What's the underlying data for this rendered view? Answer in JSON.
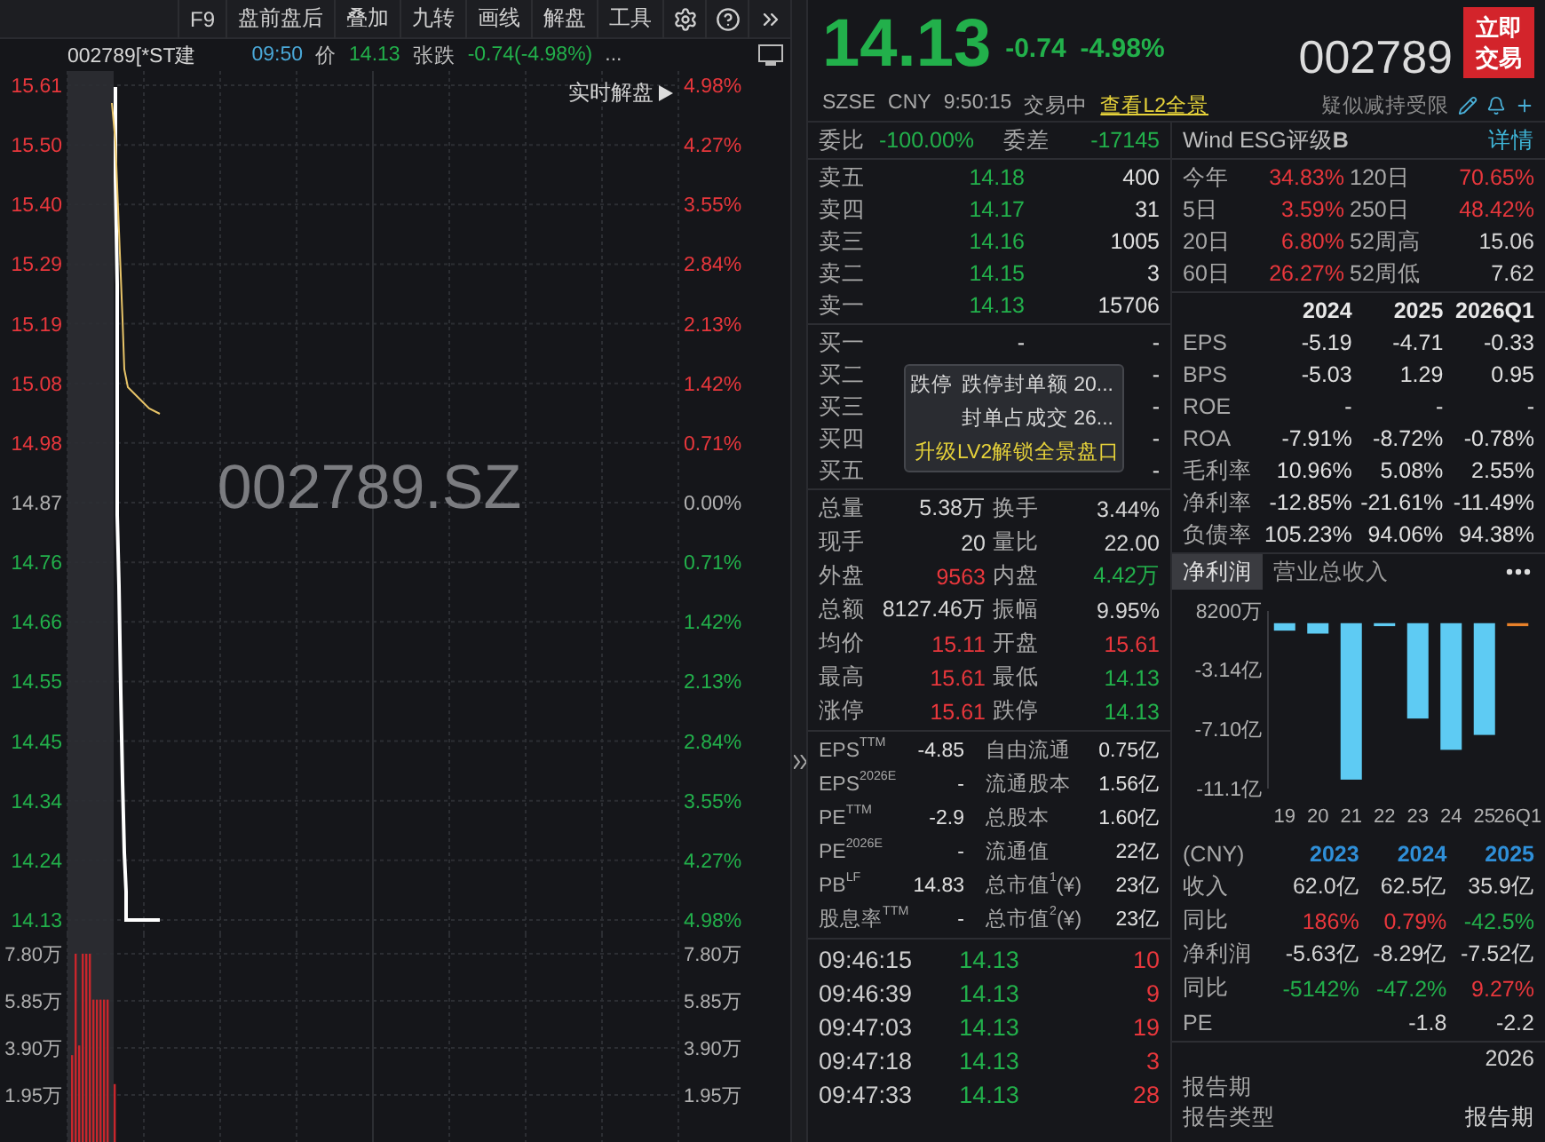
{
  "toolbar": {
    "buttons": [
      "F9",
      "盘前盘后",
      "叠加",
      "九转",
      "画线",
      "解盘",
      "工具"
    ]
  },
  "quote_line": {
    "name": "002789[*ST建",
    "time": "09:50",
    "price_label": "价",
    "price": "14.13",
    "change_label": "张跌",
    "change": "-0.74(-4.98%)",
    "color": "#22b04b",
    "more": "..."
  },
  "intraday_chart": {
    "watermark": "002789.SZ",
    "analysis_button": "实时解盘",
    "price_axis": [
      {
        "label": "15.61",
        "color": "#e8373c"
      },
      {
        "label": "15.50",
        "color": "#e8373c"
      },
      {
        "label": "15.40",
        "color": "#e8373c"
      },
      {
        "label": "15.29",
        "color": "#e8373c"
      },
      {
        "label": "15.19",
        "color": "#e8373c"
      },
      {
        "label": "15.08",
        "color": "#e8373c"
      },
      {
        "label": "14.98",
        "color": "#e8373c"
      },
      {
        "label": "14.87",
        "color": "#b0b0b0"
      },
      {
        "label": "14.76",
        "color": "#22b04b"
      },
      {
        "label": "14.66",
        "color": "#22b04b"
      },
      {
        "label": "14.55",
        "color": "#22b04b"
      },
      {
        "label": "14.45",
        "color": "#22b04b"
      },
      {
        "label": "14.34",
        "color": "#22b04b"
      },
      {
        "label": "14.24",
        "color": "#22b04b"
      },
      {
        "label": "14.13",
        "color": "#22b04b"
      }
    ],
    "percent_axis": [
      {
        "label": "4.98%",
        "color": "#e8373c"
      },
      {
        "label": "4.27%",
        "color": "#e8373c"
      },
      {
        "label": "3.55%",
        "color": "#e8373c"
      },
      {
        "label": "2.84%",
        "color": "#e8373c"
      },
      {
        "label": "2.13%",
        "color": "#e8373c"
      },
      {
        "label": "1.42%",
        "color": "#e8373c"
      },
      {
        "label": "0.71%",
        "color": "#e8373c"
      },
      {
        "label": "0.00%",
        "color": "#b0b0b0"
      },
      {
        "label": "0.71%",
        "color": "#22b04b"
      },
      {
        "label": "1.42%",
        "color": "#22b04b"
      },
      {
        "label": "2.13%",
        "color": "#22b04b"
      },
      {
        "label": "2.84%",
        "color": "#22b04b"
      },
      {
        "label": "3.55%",
        "color": "#22b04b"
      },
      {
        "label": "4.27%",
        "color": "#22b04b"
      },
      {
        "label": "4.98%",
        "color": "#22b04b"
      }
    ],
    "volume_axis_left": [
      "7.80万",
      "5.85万",
      "3.90万",
      "1.95万"
    ],
    "volume_axis_right": [
      "7.80万",
      "5.85万",
      "3.90万",
      "1.95万"
    ]
  },
  "quote": {
    "price": "14.13",
    "change": "-0.74",
    "change_pct": "-4.98%",
    "color": "#22b04b",
    "exchange": "SZSE",
    "currency": "CNY",
    "time": "9:50:15",
    "status": "交易中",
    "l2_link": "查看L2全景",
    "code": "002789",
    "trade_button": "立即交易",
    "notice": "疑似减持受限"
  },
  "order_book": {
    "ratio_label": "委比",
    "ratio": "-100.00%",
    "diff_label": "委差",
    "diff": "-17145",
    "color": "#22b04b",
    "asks": [
      {
        "label": "卖五",
        "price": "14.18",
        "volume": "400"
      },
      {
        "label": "卖四",
        "price": "14.17",
        "volume": "31"
      },
      {
        "label": "卖三",
        "price": "14.16",
        "volume": "1005"
      },
      {
        "label": "卖二",
        "price": "14.15",
        "volume": "3"
      },
      {
        "label": "卖一",
        "price": "14.13",
        "volume": "15706"
      }
    ],
    "bids": [
      {
        "label": "买一",
        "price": "-",
        "volume": "-"
      },
      {
        "label": "买二",
        "volume": "-"
      },
      {
        "label": "买三",
        "volume": "-"
      },
      {
        "label": "买四",
        "volume": "-"
      },
      {
        "label": "买五",
        "volume": "-"
      }
    ],
    "popup": {
      "tag": "跌停",
      "lines": [
        {
          "label": "跌停封单额",
          "value": "20..."
        },
        {
          "label": "封单占成交",
          "value": "26..."
        }
      ],
      "promo": "升级LV2解锁全景盘口"
    }
  },
  "stats": [
    {
      "label": "总量",
      "value": "5.38万",
      "color": "#d6d6d6"
    },
    {
      "label": "换手",
      "value": "3.44%",
      "color": "#d6d6d6"
    },
    {
      "label": "现手",
      "value": "20",
      "color": "#d6d6d6"
    },
    {
      "label": "量比",
      "value": "22.00",
      "color": "#d6d6d6"
    },
    {
      "label": "外盘",
      "value": "9563",
      "color": "#e8373c"
    },
    {
      "label": "内盘",
      "value": "4.42万",
      "color": "#22b04b"
    },
    {
      "label": "总额",
      "value": "8127.46万",
      "color": "#d6d6d6"
    },
    {
      "label": "振幅",
      "value": "9.95%",
      "color": "#d6d6d6"
    },
    {
      "label": "均价",
      "value": "15.11",
      "color": "#e8373c"
    },
    {
      "label": "开盘",
      "value": "15.61",
      "color": "#e8373c"
    },
    {
      "label": "最高",
      "value": "15.61",
      "color": "#e8373c"
    },
    {
      "label": "最低",
      "value": "14.13",
      "color": "#22b04b"
    },
    {
      "label": "涨停",
      "value": "15.61",
      "color": "#e8373c"
    },
    {
      "label": "跌停",
      "value": "14.13",
      "color": "#22b04b"
    }
  ],
  "valuation": [
    {
      "label": "EPS$^{TTM}$",
      "value": "-4.85"
    },
    {
      "label": "自由流通",
      "value": "0.75亿"
    },
    {
      "label": "EPS$^{2026E}$",
      "value": "-"
    },
    {
      "label": "流通股本",
      "value": "1.56亿"
    },
    {
      "label": "PE$^{TTM}$",
      "value": "-2.9"
    },
    {
      "label": "总股本",
      "value": "1.60亿"
    },
    {
      "label": "PE$^{2026E}$",
      "value": "-"
    },
    {
      "label": "流通值",
      "value": "22亿"
    },
    {
      "label": "PB$^{LF}$",
      "value": "14.83"
    },
    {
      "label": "总市值$^{1}$(¥)",
      "value": "23亿"
    },
    {
      "label": "股息率$^{TTM}$",
      "value": "-"
    },
    {
      "label": "总市值$^{2}$(¥)",
      "value": "23亿"
    }
  ],
  "ticks": [
    {
      "time": "09:46:15",
      "price": {
        "text": "14.13",
        "color": "#22b04b"
      },
      "volume": {
        "text": "10",
        "color": "#e8373c"
      }
    },
    {
      "time": "09:46:39",
      "price": {
        "text": "14.13",
        "color": "#22b04b"
      },
      "volume": {
        "text": "9",
        "color": "#e8373c"
      }
    },
    {
      "time": "09:47:03",
      "price": {
        "text": "14.13",
        "color": "#22b04b"
      },
      "volume": {
        "text": "19",
        "color": "#e8373c"
      }
    },
    {
      "time": "09:47:18",
      "price": {
        "text": "14.13",
        "color": "#22b04b"
      },
      "volume": {
        "text": "3",
        "color": "#e8373c"
      }
    },
    {
      "time": "09:47:33",
      "price": {
        "text": "14.13",
        "color": "#22b04b"
      },
      "volume": {
        "text": "28",
        "color": "#e8373c"
      }
    }
  ],
  "esg": {
    "label": "Wind ESG评级**B**",
    "details_link": "详情"
  },
  "returns": [
    {
      "label": "今年",
      "value": "34.83%",
      "color": "#e8373c"
    },
    {
      "label": "120日",
      "value": "70.65%",
      "color": "#e8373c"
    },
    {
      "label": "5日",
      "value": "3.59%",
      "color": "#e8373c"
    },
    {
      "label": "250日",
      "value": "48.42%",
      "color": "#e8373c"
    },
    {
      "label": "20日",
      "value": "6.80%",
      "color": "#e8373c"
    },
    {
      "label": "52周高",
      "value": "15.06",
      "color": "#d6d6d6"
    },
    {
      "label": "60日",
      "value": "26.27%",
      "color": "#e8373c"
    },
    {
      "label": "52周低",
      "value": "7.62",
      "color": "#d6d6d6"
    }
  ],
  "financials": {
    "columns": [
      "2024",
      "2025",
      "2026Q1"
    ],
    "rows": [
      {
        "label": "EPS",
        "values": [
          "-5.19",
          "-4.71",
          "-0.33"
        ]
      },
      {
        "label": "BPS",
        "values": [
          "-5.03",
          "1.29",
          "0.95"
        ]
      },
      {
        "label": "ROE",
        "values": [
          "-",
          "-",
          "-"
        ]
      },
      {
        "label": "ROA",
        "values": [
          "-7.91%",
          "-8.72%",
          "-0.78%"
        ]
      },
      {
        "label": "毛利率",
        "values": [
          "10.96%",
          "5.08%",
          "2.55%"
        ]
      },
      {
        "label": "净利率",
        "values": [
          "-12.85%",
          "-21.61%",
          "-11.49%"
        ]
      },
      {
        "label": "负债率",
        "values": [
          "105.23%",
          "94.06%",
          "94.38%"
        ]
      }
    ]
  },
  "profit_tabs": [
    {
      "label": "净利润",
      "selected": true
    },
    {
      "label": "营业总收入",
      "selected": false
    }
  ],
  "profit_chart": {
    "top_label": "8200万",
    "chart_data": {
      "type": "bar",
      "categories": [
        "19",
        "20",
        "21",
        "22",
        "23",
        "24",
        "25",
        "26Q1"
      ],
      "ylim": [
        -11.1,
        0.82
      ],
      "yticks": [
        {
          "value": -3.14,
          "label": "-3.14亿"
        },
        {
          "value": -7.1,
          "label": "-7.10亿"
        },
        {
          "value": -11.1,
          "label": "-11.1亿"
        }
      ],
      "series": [
        {
          "color": "#5ecbf3",
          "values": [
            -0.5,
            -0.7,
            -10.5,
            -0.2,
            -6.4,
            -8.5,
            -7.5,
            null
          ]
        },
        {
          "color": "#e8812a",
          "values": [
            null,
            null,
            null,
            null,
            null,
            null,
            null,
            -0.2
          ]
        }
      ]
    }
  },
  "summary": {
    "columns": [
      "(CNY)",
      "2023",
      "2024",
      "2025"
    ],
    "rows": [
      {
        "label": "收入",
        "values": [
          {
            "text": "62.0亿",
            "color": "#d6d6d6"
          },
          {
            "text": "62.5亿",
            "color": "#d6d6d6"
          },
          {
            "text": "35.9亿",
            "color": "#d6d6d6"
          }
        ]
      },
      {
        "label": "同比",
        "values": [
          {
            "text": "186%",
            "color": "#e8373c"
          },
          {
            "text": "0.79%",
            "color": "#e8373c"
          },
          {
            "text": "-42.5%",
            "color": "#22b04b"
          }
        ]
      },
      {
        "label": "净利润",
        "values": [
          {
            "text": "-5.63亿",
            "color": "#d6d6d6"
          },
          {
            "text": "-8.29亿",
            "color": "#d6d6d6"
          },
          {
            "text": "-7.52亿",
            "color": "#d6d6d6"
          }
        ]
      },
      {
        "label": "同比",
        "values": [
          {
            "text": "-5142%",
            "color": "#22b04b"
          },
          {
            "text": "-47.2%",
            "color": "#22b04b"
          },
          {
            "text": "9.27%",
            "color": "#e8373c"
          }
        ]
      },
      {
        "label": "PE",
        "values": [
          {
            "text": "-1.8",
            "color": "#d6d6d6"
          },
          {
            "text": "-2.2",
            "color": "#d6d6d6"
          }
        ]
      }
    ]
  },
  "info_rows": [
    {
      "value": "2026"
    },
    {
      "label": "报告期"
    },
    {
      "label": "报告类型",
      "value": "报告期"
    }
  ]
}
